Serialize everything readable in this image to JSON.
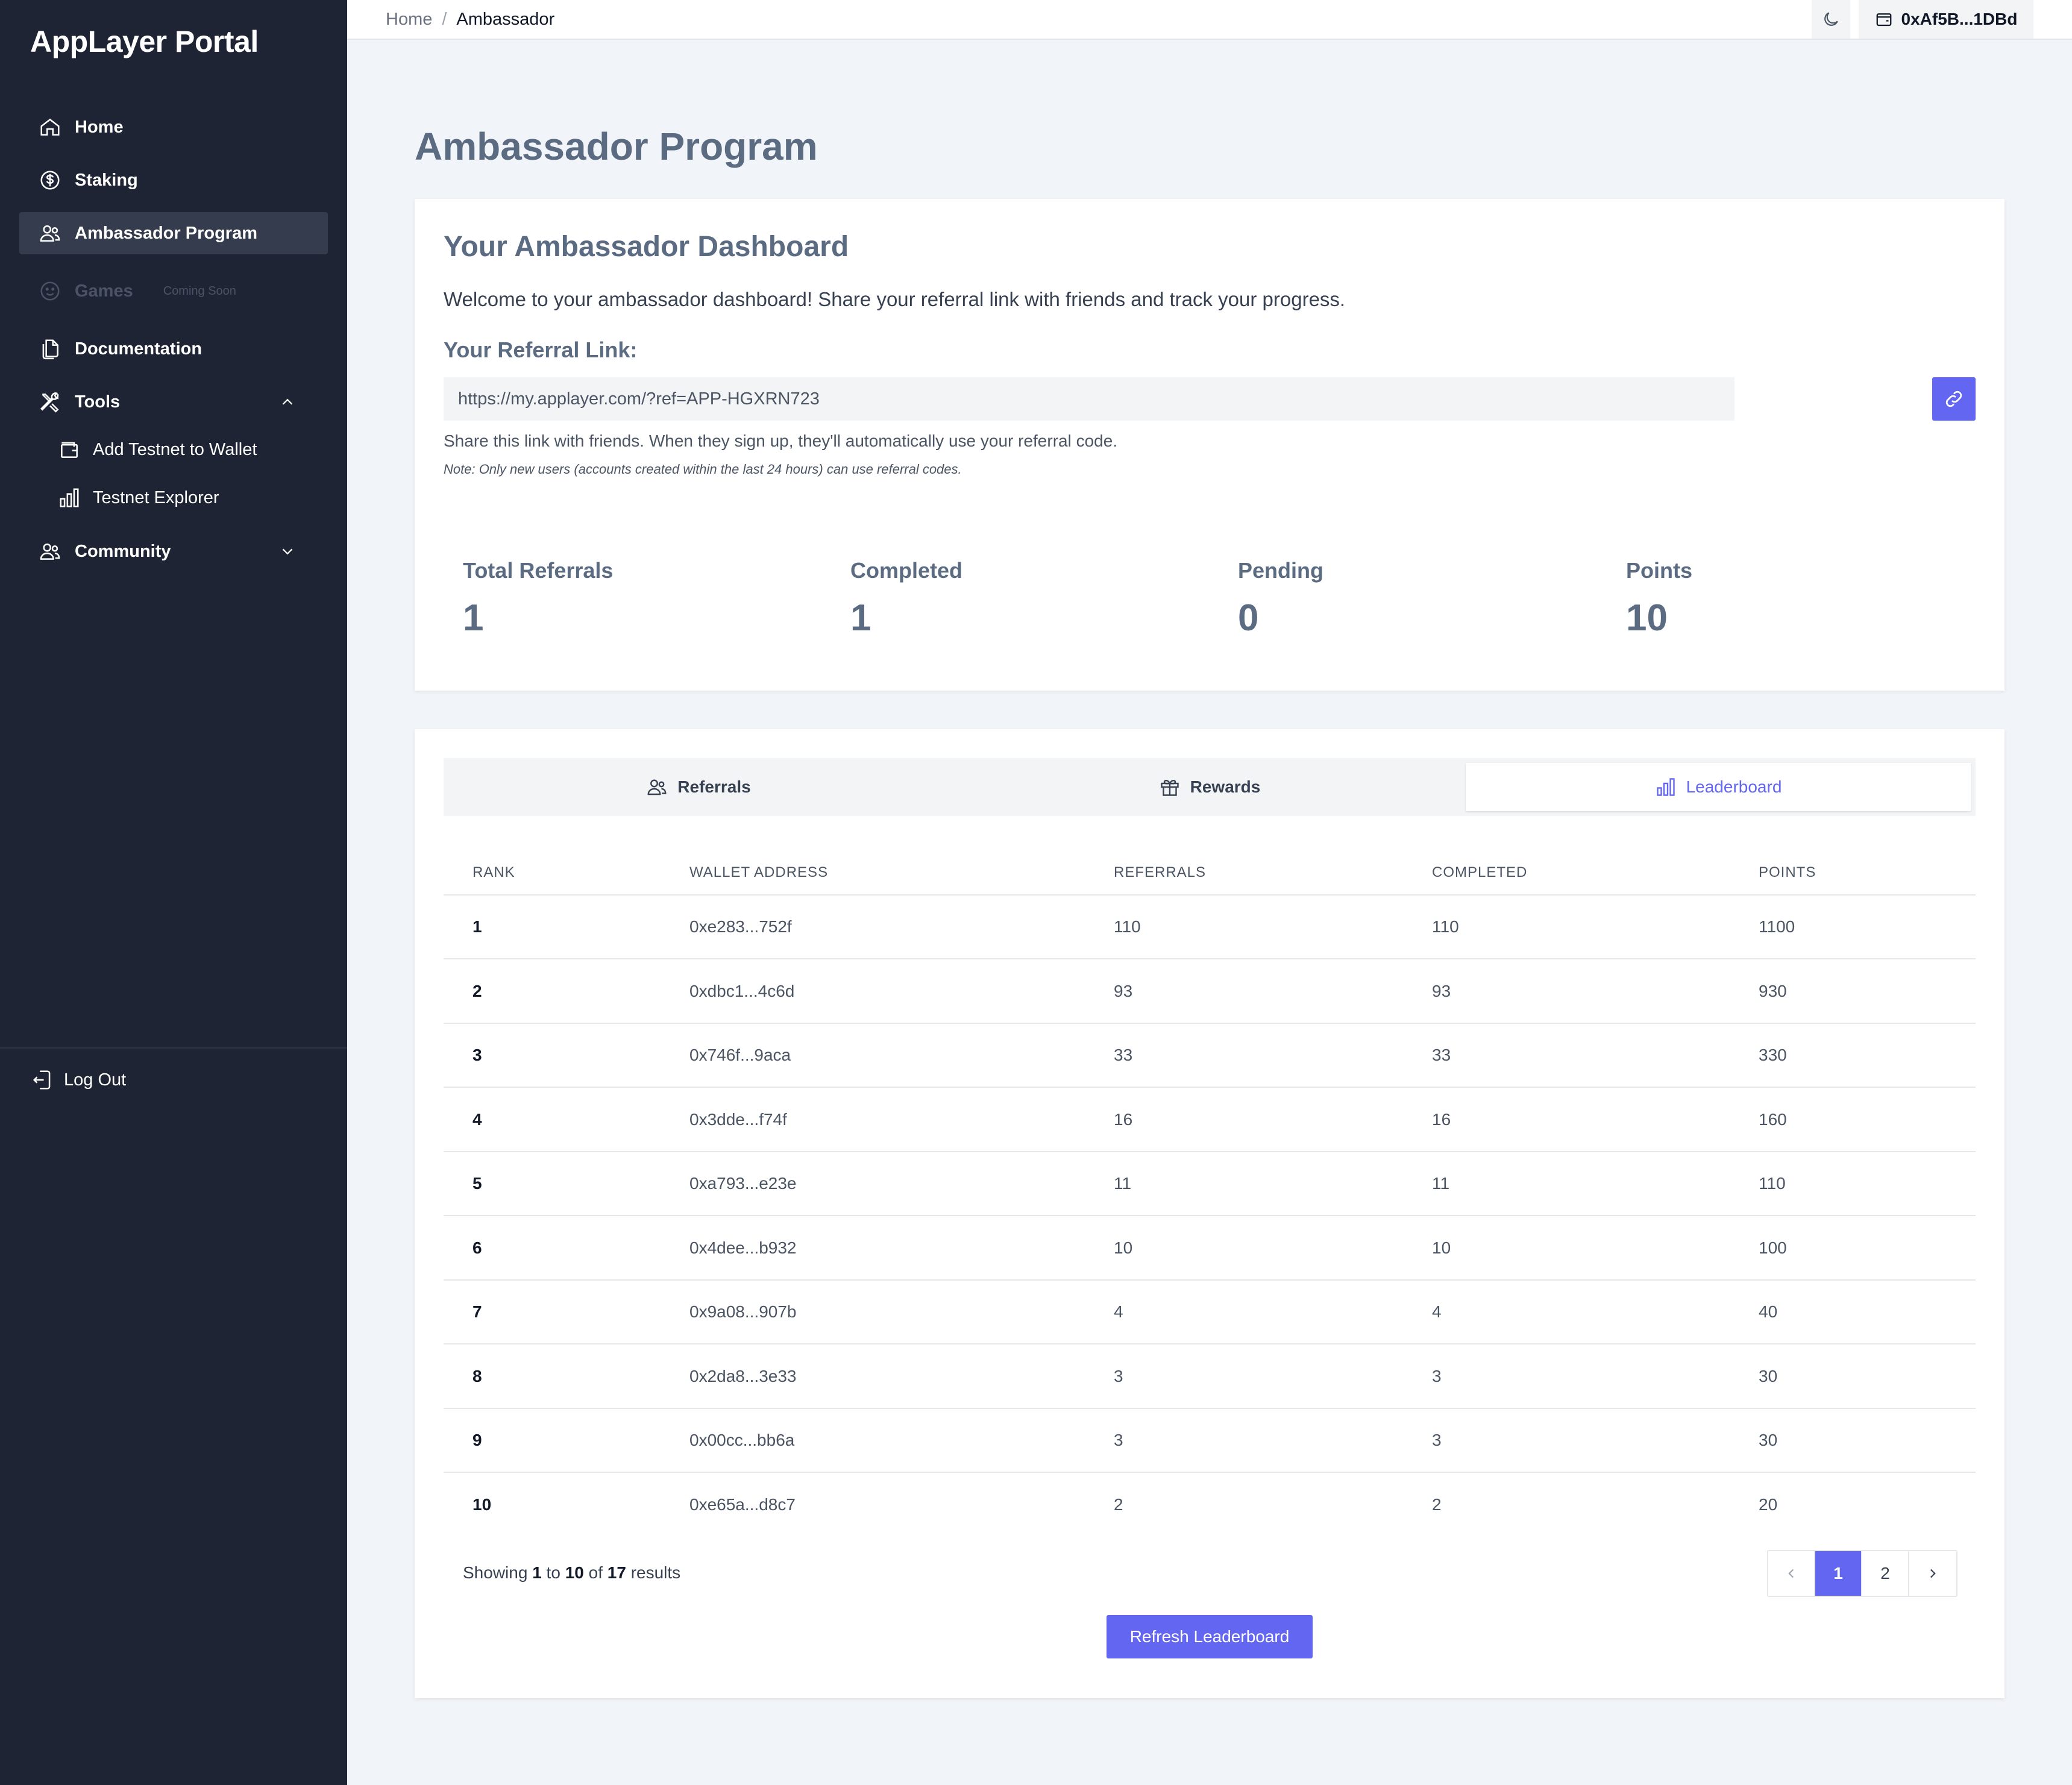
{
  "app": {
    "logo": "AppLayer Portal"
  },
  "sidebar": {
    "items": [
      {
        "label": "Home"
      },
      {
        "label": "Staking"
      },
      {
        "label": "Ambassador Program"
      },
      {
        "label": "Games",
        "badge": "Coming Soon"
      },
      {
        "label": "Documentation"
      },
      {
        "label": "Tools"
      },
      {
        "label": "Community"
      }
    ],
    "tools_sub": [
      {
        "label": "Add Testnet to Wallet"
      },
      {
        "label": "Testnet Explorer"
      }
    ],
    "logout": "Log Out"
  },
  "topbar": {
    "breadcrumb_home": "Home",
    "breadcrumb_sep": "/",
    "breadcrumb_current": "Ambassador",
    "wallet": "0xAf5B...1DBd"
  },
  "page": {
    "title": "Ambassador Program"
  },
  "dashboard": {
    "title": "Your Ambassador Dashboard",
    "welcome": "Welcome to your ambassador dashboard! Share your referral link with friends and track your progress.",
    "ref_label": "Your Referral Link:",
    "ref_link": "https://my.applayer.com/?ref=APP-HGXRN723",
    "share_hint": "Share this link with friends. When they sign up, they'll automatically use your referral code.",
    "note": "Note: Only new users (accounts created within the last 24 hours) can use referral codes.",
    "stats": [
      {
        "label": "Total Referrals",
        "value": "1"
      },
      {
        "label": "Completed",
        "value": "1"
      },
      {
        "label": "Pending",
        "value": "0"
      },
      {
        "label": "Points",
        "value": "10"
      }
    ]
  },
  "tabs": [
    {
      "label": "Referrals"
    },
    {
      "label": "Rewards"
    },
    {
      "label": "Leaderboard"
    }
  ],
  "leaderboard": {
    "columns": [
      "RANK",
      "WALLET ADDRESS",
      "REFERRALS",
      "COMPLETED",
      "POINTS"
    ],
    "rows": [
      [
        "1",
        "0xe283...752f",
        "110",
        "110",
        "1100"
      ],
      [
        "2",
        "0xdbc1...4c6d",
        "93",
        "93",
        "930"
      ],
      [
        "3",
        "0x746f...9aca",
        "33",
        "33",
        "330"
      ],
      [
        "4",
        "0x3dde...f74f",
        "16",
        "16",
        "160"
      ],
      [
        "5",
        "0xa793...e23e",
        "11",
        "11",
        "110"
      ],
      [
        "6",
        "0x4dee...b932",
        "10",
        "10",
        "100"
      ],
      [
        "7",
        "0x9a08...907b",
        "4",
        "4",
        "40"
      ],
      [
        "8",
        "0x2da8...3e33",
        "3",
        "3",
        "30"
      ],
      [
        "9",
        "0x00cc...bb6a",
        "3",
        "3",
        "30"
      ],
      [
        "10",
        "0xe65a...d8c7",
        "2",
        "2",
        "20"
      ]
    ],
    "showing_prefix": "Showing",
    "showing_from": "1",
    "showing_to_word": "to",
    "showing_to": "10",
    "showing_of_word": "of",
    "showing_total": "17",
    "showing_suffix": "results",
    "pages": [
      "1",
      "2"
    ],
    "refresh_label": "Refresh Leaderboard"
  },
  "colors": {
    "accent": "#6366f1",
    "sidebar_bg": "#1e2433",
    "page_bg": "#f1f4f8"
  }
}
